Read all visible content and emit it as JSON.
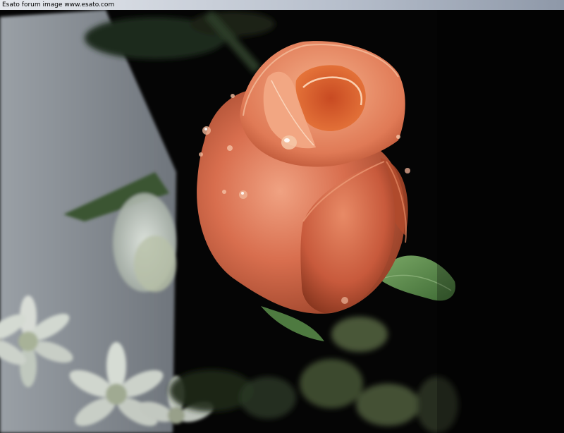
{
  "watermark": {
    "text": "Esato forum image www.esato.com"
  },
  "scene": {
    "subject": "rose-bud",
    "colors": {
      "background": "#050505",
      "wall": "#8a9096",
      "rose_main": "#d86e4e",
      "rose_shadow": "#8e3a22",
      "rose_highlight": "#f0a282",
      "leaf": "#5a8a4a",
      "flower_white": "#c8cfc8"
    }
  }
}
